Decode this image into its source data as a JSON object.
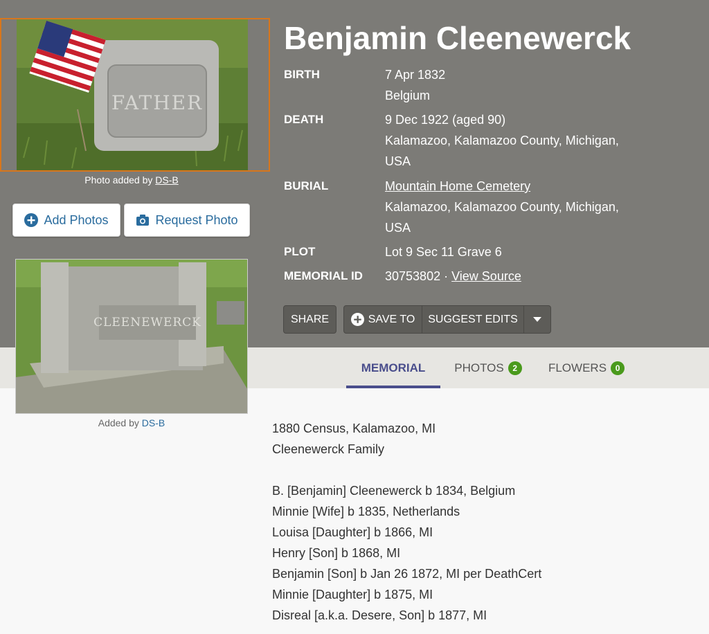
{
  "memorial": {
    "name": "Benjamin Cleenewerck",
    "facts": {
      "birth_label": "BIRTH",
      "birth_date": "7 Apr 1832",
      "birth_place": "Belgium",
      "death_label": "DEATH",
      "death_date": "9 Dec 1922 (aged 90)",
      "death_place_1": "Kalamazoo, Kalamazoo County, Michigan,",
      "death_place_2": "USA",
      "burial_label": "BURIAL",
      "burial_cemetery": "Mountain Home Cemetery",
      "burial_place_1": "Kalamazoo, Kalamazoo County, Michigan,",
      "burial_place_2": "USA",
      "plot_label": "PLOT",
      "plot_value": "Lot 9 Sec 11 Grave 6",
      "memorial_id_label": "MEMORIAL ID",
      "memorial_id_value": "30753802 ·",
      "view_source": "View Source"
    }
  },
  "photos": {
    "main_caption_prefix": "Photo added by",
    "main_caption_user": "DS-B",
    "second_caption_prefix": "Added by",
    "second_caption_user": "DS-B",
    "headstone_text_main": "FATHER",
    "headstone_text_second": "CLEENEWERCK"
  },
  "buttons": {
    "add_photos": "Add Photos",
    "request_photo": "Request Photo",
    "share": "SHARE",
    "save_to": "SAVE TO",
    "suggest_edits": "SUGGEST EDITS"
  },
  "tabs": {
    "memorial": "MEMORIAL",
    "photos": "PHOTOS",
    "photos_count": "2",
    "flowers": "FLOWERS",
    "flowers_count": "0"
  },
  "bio": {
    "lines": [
      "1880 Census, Kalamazoo, MI",
      "Cleenewerck Family",
      "",
      "B. [Benjamin] Cleenewerck b 1834, Belgium",
      "Minnie [Wife] b 1835, Netherlands",
      "Louisa [Daughter] b 1866, MI",
      "Henry [Son] b 1868, MI",
      "Benjamin [Son] b Jan 26 1872, MI per DeathCert",
      "Minnie [Daughter] b 1875, MI",
      "Disreal [a.k.a. Desere, Son] b 1877, MI"
    ]
  },
  "colors": {
    "hero_bg": "#7c7b77",
    "tab_bar_bg": "#e7e6e2",
    "active_tab": "#4a4e8c",
    "photo_border": "#d8761c",
    "link_blue": "#2a6c9e",
    "badge_green": "#4a9a1c"
  },
  "icons": {
    "add_photos": "plus-circle-icon",
    "request_photo": "camera-icon",
    "save_to": "plus-circle-icon",
    "more": "caret-down-icon"
  }
}
